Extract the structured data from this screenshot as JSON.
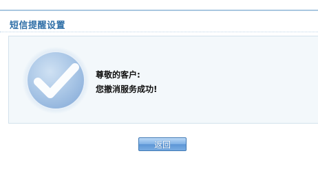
{
  "header": {
    "title": "短信提醒设置"
  },
  "message": {
    "greeting": "尊敬的客户:",
    "body": "您撤消服务成功!"
  },
  "actions": {
    "back_label": "返回"
  },
  "colors": {
    "title": "#2f6fa7",
    "panel_background": "#f3f8fb",
    "button_accent": "#5d96d6"
  },
  "icons": {
    "status": "checkmark-circle-icon"
  }
}
